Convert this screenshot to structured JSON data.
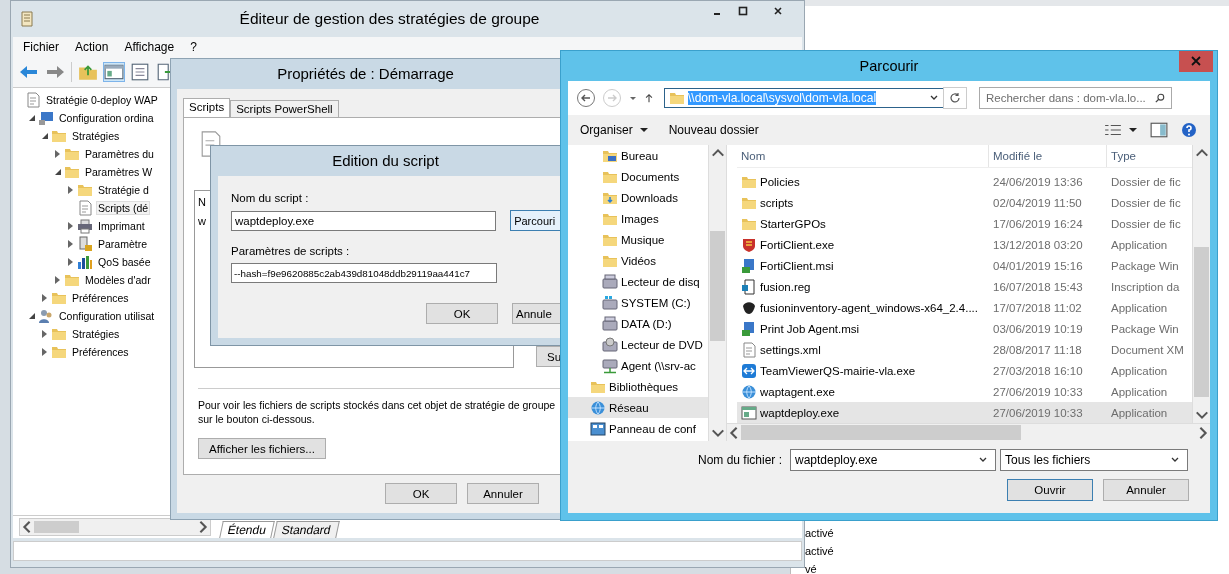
{
  "background_window": {
    "rows": [
      "activé",
      "activé",
      "vé"
    ]
  },
  "main_window": {
    "title": "Éditeur de gestion des stratégies de groupe",
    "menu": [
      "Fichier",
      "Action",
      "Affichage",
      "?"
    ],
    "tree": [
      {
        "label": "Stratégie 0-deploy WAP",
        "kind": "policy",
        "selected": false,
        "children": [
          {
            "label": "Configuration ordina",
            "kind": "computer",
            "selected": false,
            "expanded": true,
            "children": [
              {
                "label": "Stratégies",
                "kind": "folder",
                "selected": false,
                "expanded": true,
                "children": [
                  {
                    "label": "Paramètres du",
                    "kind": "folder",
                    "selected": false,
                    "expanded": false
                  },
                  {
                    "label": "Paramètres W",
                    "kind": "folder",
                    "selected": false,
                    "expanded": true,
                    "children": [
                      {
                        "label": "Stratégie d",
                        "kind": "folder",
                        "selected": false,
                        "expanded": false
                      },
                      {
                        "label": "Scripts (dé",
                        "kind": "script",
                        "selected": true
                      },
                      {
                        "label": "Imprimant",
                        "kind": "printer",
                        "selected": false,
                        "expanded": false
                      },
                      {
                        "label": "Paramètre",
                        "kind": "security",
                        "selected": false,
                        "expanded": false
                      },
                      {
                        "label": "QoS basée",
                        "kind": "chart",
                        "selected": false,
                        "expanded": false
                      }
                    ]
                  },
                  {
                    "label": "Modèles d'adr",
                    "kind": "folder",
                    "selected": false,
                    "expanded": false
                  }
                ]
              },
              {
                "label": "Préférences",
                "kind": "folder",
                "selected": false,
                "expanded": false
              }
            ]
          },
          {
            "label": "Configuration utilisat",
            "kind": "user",
            "selected": false,
            "expanded": true,
            "children": [
              {
                "label": "Stratégies",
                "kind": "folder",
                "selected": false,
                "expanded": false
              },
              {
                "label": "Préférences",
                "kind": "folder",
                "selected": false,
                "expanded": false
              }
            ]
          }
        ]
      }
    ],
    "view_tabs": [
      {
        "label": "Étendu",
        "selected": true
      },
      {
        "label": "Standard",
        "selected": false
      }
    ]
  },
  "properties_dialog": {
    "title": "Propriétés de : Démarrage",
    "tabs": [
      {
        "label": "Scripts",
        "selected": true
      },
      {
        "label": "Scripts PowerShell",
        "selected": false
      }
    ],
    "script_list": {
      "column_1": "N",
      "rows": [
        "w"
      ]
    },
    "side_button": "Su",
    "info_lines": [
      "Pour voir les fichiers de scripts stockés dans cet objet de stratégie de groupe",
      "sur le bouton ci-dessous."
    ],
    "show_files_button": "Afficher les fichiers...",
    "buttons": [
      "OK",
      "Annuler"
    ]
  },
  "edit_dialog": {
    "title": "Edition du script",
    "name_label": "Nom du script :",
    "name_value": "waptdeploy.exe",
    "browse_button": "Parcouri",
    "params_label": "Paramètres de scripts :",
    "params_value": "--hash=f9e9620885c2ab439d81048ddb29119aa441c7",
    "buttons": [
      "OK",
      "Annule"
    ]
  },
  "browse_dialog": {
    "title": "Parcourir",
    "address": "\\\\dom-vla.local\\sysvol\\dom-vla.local",
    "search": {
      "placeholder": "Rechercher dans : dom-vla.lo..."
    },
    "toolbar": [
      "Organiser",
      "Nouveau dossier"
    ],
    "nav": [
      {
        "children": [
          {
            "label": "Bureau",
            "kind": "desktop",
            "selected": false
          },
          {
            "label": "Documents",
            "kind": "documents",
            "selected": false
          },
          {
            "label": "Downloads",
            "kind": "downloads",
            "selected": false
          },
          {
            "label": "Images",
            "kind": "images",
            "selected": false
          },
          {
            "label": "Musique",
            "kind": "music",
            "selected": false
          },
          {
            "label": "Vidéos",
            "kind": "videos",
            "selected": false
          },
          {
            "label": "Lecteur de disq",
            "kind": "drive",
            "selected": false
          },
          {
            "label": "SYSTEM (C:)",
            "kind": "system",
            "selected": false
          },
          {
            "label": "DATA (D:)",
            "kind": "drive",
            "selected": false
          },
          {
            "label": "Lecteur de DVD",
            "kind": "dvd",
            "selected": false
          },
          {
            "label": "Agent (\\\\srv-ac",
            "kind": "netdrive",
            "selected": false
          }
        ]
      },
      {
        "label": "Bibliothèques",
        "kind": "library",
        "selected": false
      },
      {
        "label": "Réseau",
        "kind": "network",
        "selected": true
      },
      {
        "label": "Panneau de conf",
        "kind": "control",
        "selected": false
      }
    ],
    "columns": [
      "Nom",
      "Modifié le",
      "Type"
    ],
    "files": [
      {
        "name": "Policies",
        "modified": "24/06/2019 13:36",
        "type": "Dossier de fic",
        "kind": "folder",
        "selected": false
      },
      {
        "name": "scripts",
        "modified": "02/04/2019 11:50",
        "type": "Dossier de fic",
        "kind": "folder",
        "selected": false
      },
      {
        "name": "StarterGPOs",
        "modified": "17/06/2019 16:24",
        "type": "Dossier de fic",
        "kind": "folder",
        "selected": false
      },
      {
        "name": "FortiClient.exe",
        "modified": "13/12/2018 03:20",
        "type": "Application",
        "kind": "shield",
        "selected": false
      },
      {
        "name": "FortiClient.msi",
        "modified": "04/01/2019 15:16",
        "type": "Package Win",
        "kind": "installer",
        "selected": false
      },
      {
        "name": "fusion.reg",
        "modified": "16/07/2018 15:43",
        "type": "Inscription da",
        "kind": "registry",
        "selected": false
      },
      {
        "name": "fusioninventory-agent_windows-x64_2.4....",
        "modified": "17/07/2018 11:02",
        "type": "Application",
        "kind": "dark",
        "selected": false
      },
      {
        "name": "Print Job Agent.msi",
        "modified": "03/06/2019 10:19",
        "type": "Package Win",
        "kind": "installer",
        "selected": false
      },
      {
        "name": "settings.xml",
        "modified": "28/08/2017 11:18",
        "type": "Document XM",
        "kind": "xml",
        "selected": false
      },
      {
        "name": "TeamViewerQS-mairie-vla.exe",
        "modified": "27/03/2018 16:10",
        "type": "Application",
        "kind": "bluebox",
        "selected": false
      },
      {
        "name": "waptagent.exe",
        "modified": "27/06/2019 10:33",
        "type": "Application",
        "kind": "globe",
        "selected": false
      },
      {
        "name": "waptdeploy.exe",
        "modified": "27/06/2019 10:33",
        "type": "Application",
        "kind": "window",
        "selected": true
      }
    ],
    "filename_label": "Nom du fichier :",
    "filename_value": "waptdeploy.exe",
    "filter": "Tous les fichiers",
    "buttons": [
      "Ouvrir",
      "Annuler"
    ]
  }
}
